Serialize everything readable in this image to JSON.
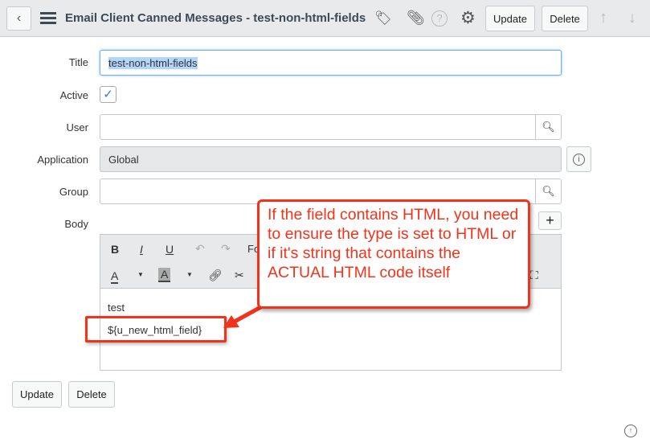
{
  "header": {
    "title": "Email Client Canned Messages - test-non-html-fields",
    "update": "Update",
    "delete": "Delete"
  },
  "form": {
    "title_label": "Title",
    "title_value": "test-non-html-fields",
    "active_label": "Active",
    "active_checked": true,
    "user_label": "User",
    "user_value": "",
    "application_label": "Application",
    "application_value": "Global",
    "group_label": "Group",
    "group_value": "",
    "body_label": "Body",
    "toolbar": {
      "bold": "B",
      "italic": "I",
      "underline": "U",
      "font": "Fo",
      "text_color": "A",
      "bg_color": "A"
    },
    "body_lines": [
      "test",
      "${u_new_html_field}"
    ]
  },
  "annotation": "If the field contains HTML, you need to ensure the type is set to HTML or if it's string that contains the ACTUAL HTML code itself",
  "footer": {
    "update": "Update",
    "delete": "Delete"
  }
}
